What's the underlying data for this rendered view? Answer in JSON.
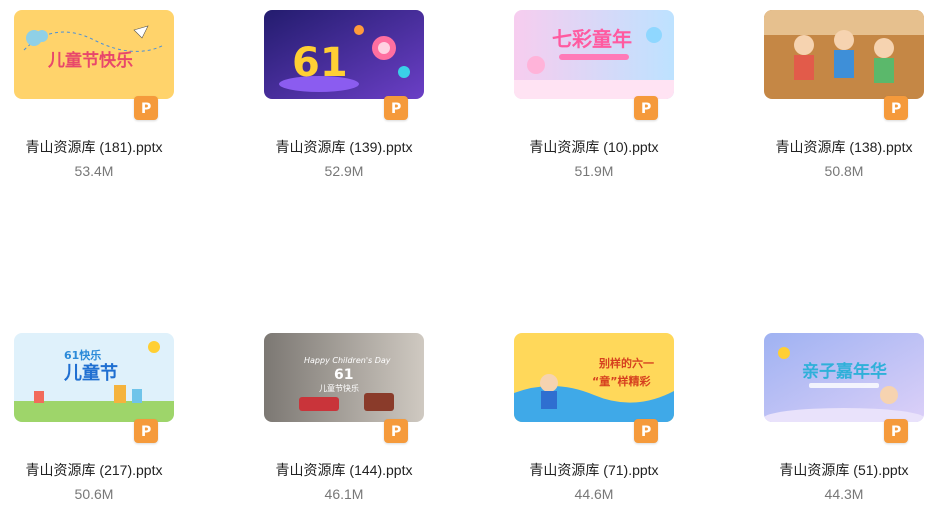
{
  "files": [
    {
      "name": "青山资源库 (181).pptx",
      "size": "53.4M",
      "thumb_text": "儿童节快乐",
      "thumb_colors": [
        "#ffd36b",
        "#ffcf5c"
      ],
      "icon": "pptx-file-icon"
    },
    {
      "name": "青山资源库 (139).pptx",
      "size": "52.9M",
      "thumb_text": "61",
      "thumb_colors": [
        "#2d2380",
        "#6a3fc4"
      ],
      "icon": "pptx-file-icon"
    },
    {
      "name": "青山资源库 (10).pptx",
      "size": "51.9M",
      "thumb_text": "七彩童年",
      "thumb_colors": [
        "#f7d4f5",
        "#bfe4ff"
      ],
      "icon": "pptx-file-icon"
    },
    {
      "name": "青山资源库 (138).pptx",
      "size": "50.8M",
      "thumb_text": "",
      "thumb_colors": [
        "#b57a3c",
        "#d9a061"
      ],
      "icon": "pptx-file-icon"
    },
    {
      "name": "青山资源库 (217).pptx",
      "size": "50.6M",
      "thumb_text": "61快乐 儿童节",
      "thumb_colors": [
        "#d8eef9",
        "#a5d86a"
      ],
      "icon": "pptx-file-icon"
    },
    {
      "name": "青山资源库 (144).pptx",
      "size": "46.1M",
      "thumb_text": "Happy Children's Day 61 儿童节快乐",
      "thumb_colors": [
        "#8a8784",
        "#c9c4bd"
      ],
      "icon": "pptx-file-icon"
    },
    {
      "name": "青山资源库 (71).pptx",
      "size": "44.6M",
      "thumb_text": "别样的六一 “童”样精彩",
      "thumb_colors": [
        "#ffd85a",
        "#3fa9e8"
      ],
      "icon": "pptx-file-icon"
    },
    {
      "name": "青山资源库 (51).pptx",
      "size": "44.3M",
      "thumb_text": "亲子嘉年华",
      "thumb_colors": [
        "#9fb2f2",
        "#d7c8f7"
      ],
      "icon": "pptx-file-icon"
    }
  ]
}
